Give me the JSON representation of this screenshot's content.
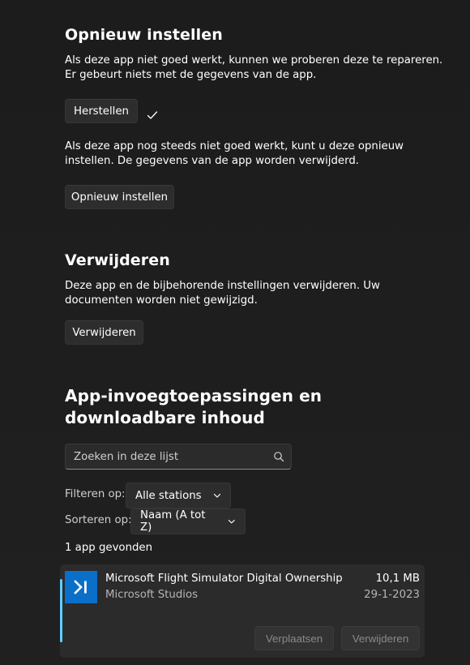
{
  "reset_section": {
    "title": "Opnieuw instellen",
    "repair_description": "Als deze app niet goed werkt, kunnen we proberen deze te repareren. Er gebeurt niets met de gegevens van de app.",
    "repair_button": "Herstellen",
    "reset_description": "Als deze app nog steeds niet goed werkt, kunt u deze opnieuw instellen. De gegevens van de app worden verwijderd.",
    "reset_button": "Opnieuw instellen"
  },
  "remove_section": {
    "title": "Verwijderen",
    "description": "Deze app en de bijbehorende instellingen verwijderen. Uw documenten worden niet gewijzigd.",
    "remove_button": "Verwijderen"
  },
  "addons_section": {
    "title": "App-invoegtoepassingen en downloadbare inhoud",
    "search_placeholder": "Zoeken in deze lijst",
    "filter_label": "Filteren op:",
    "filter_value": "Alle stations",
    "sort_label": "Sorteren op:",
    "sort_value": "Naam (A tot Z)",
    "result_count": "1 app gevonden",
    "items": [
      {
        "name": "Microsoft Flight Simulator Digital Ownership",
        "publisher": "Microsoft Studios",
        "size": "10,1 MB",
        "date": "29-1-2023",
        "move_button": "Verplaatsen",
        "uninstall_button": "Verwijderen"
      }
    ]
  },
  "colors": {
    "background": "#1c1c1c",
    "card": "#2b2b2b",
    "accent": "#60cdff",
    "app_icon": "#0a6fc9"
  },
  "icons": {
    "repair_status": "checkmark-icon",
    "search": "search-icon",
    "dropdown": "chevron-down-icon",
    "app": "flight-simulator-app-icon"
  }
}
